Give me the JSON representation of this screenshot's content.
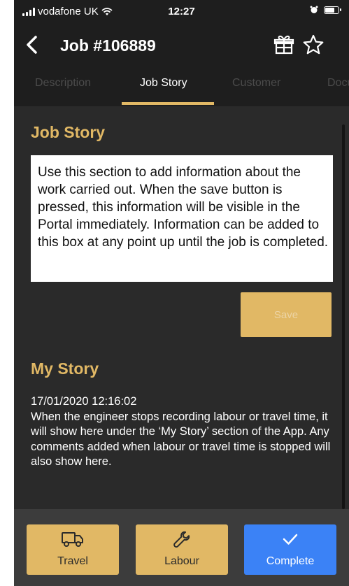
{
  "status_bar": {
    "carrier": "vodafone UK",
    "time": "12:27"
  },
  "header": {
    "title": "Job #106889",
    "icons": [
      "back-chevron-icon",
      "gift-icon",
      "star-icon"
    ]
  },
  "tabs": [
    {
      "label": "Description",
      "active": false
    },
    {
      "label": "Job Story",
      "active": true
    },
    {
      "label": "Customer",
      "active": false
    },
    {
      "label": "Documents",
      "active": false
    }
  ],
  "job_story": {
    "heading": "Job Story",
    "placeholder": "Use this section to add information about the work carried out. When the save button is pressed, this information will be visible in the Portal immediately. Information can be added to this box at any point up until the job is completed.",
    "save_label": "Save"
  },
  "my_story": {
    "heading": "My Story",
    "entries": [
      {
        "timestamp": "17/01/2020 12:16:02",
        "text": "When the engineer stops recording labour or travel time, it will show here under the ‘My Story’ section of the App. Any comments added when labour or travel time is stopped will also show here."
      }
    ]
  },
  "actions": [
    {
      "label": "Travel",
      "icon": "truck-icon"
    },
    {
      "label": "Labour",
      "icon": "wrench-icon"
    },
    {
      "label": "Complete",
      "icon": "checkmark-icon"
    }
  ],
  "colors": {
    "accent": "#e1b865",
    "background": "#2a2a2a",
    "header": "#1e1e1e",
    "bottom_bar": "#3c3c3c",
    "complete": "#3b82f6"
  }
}
